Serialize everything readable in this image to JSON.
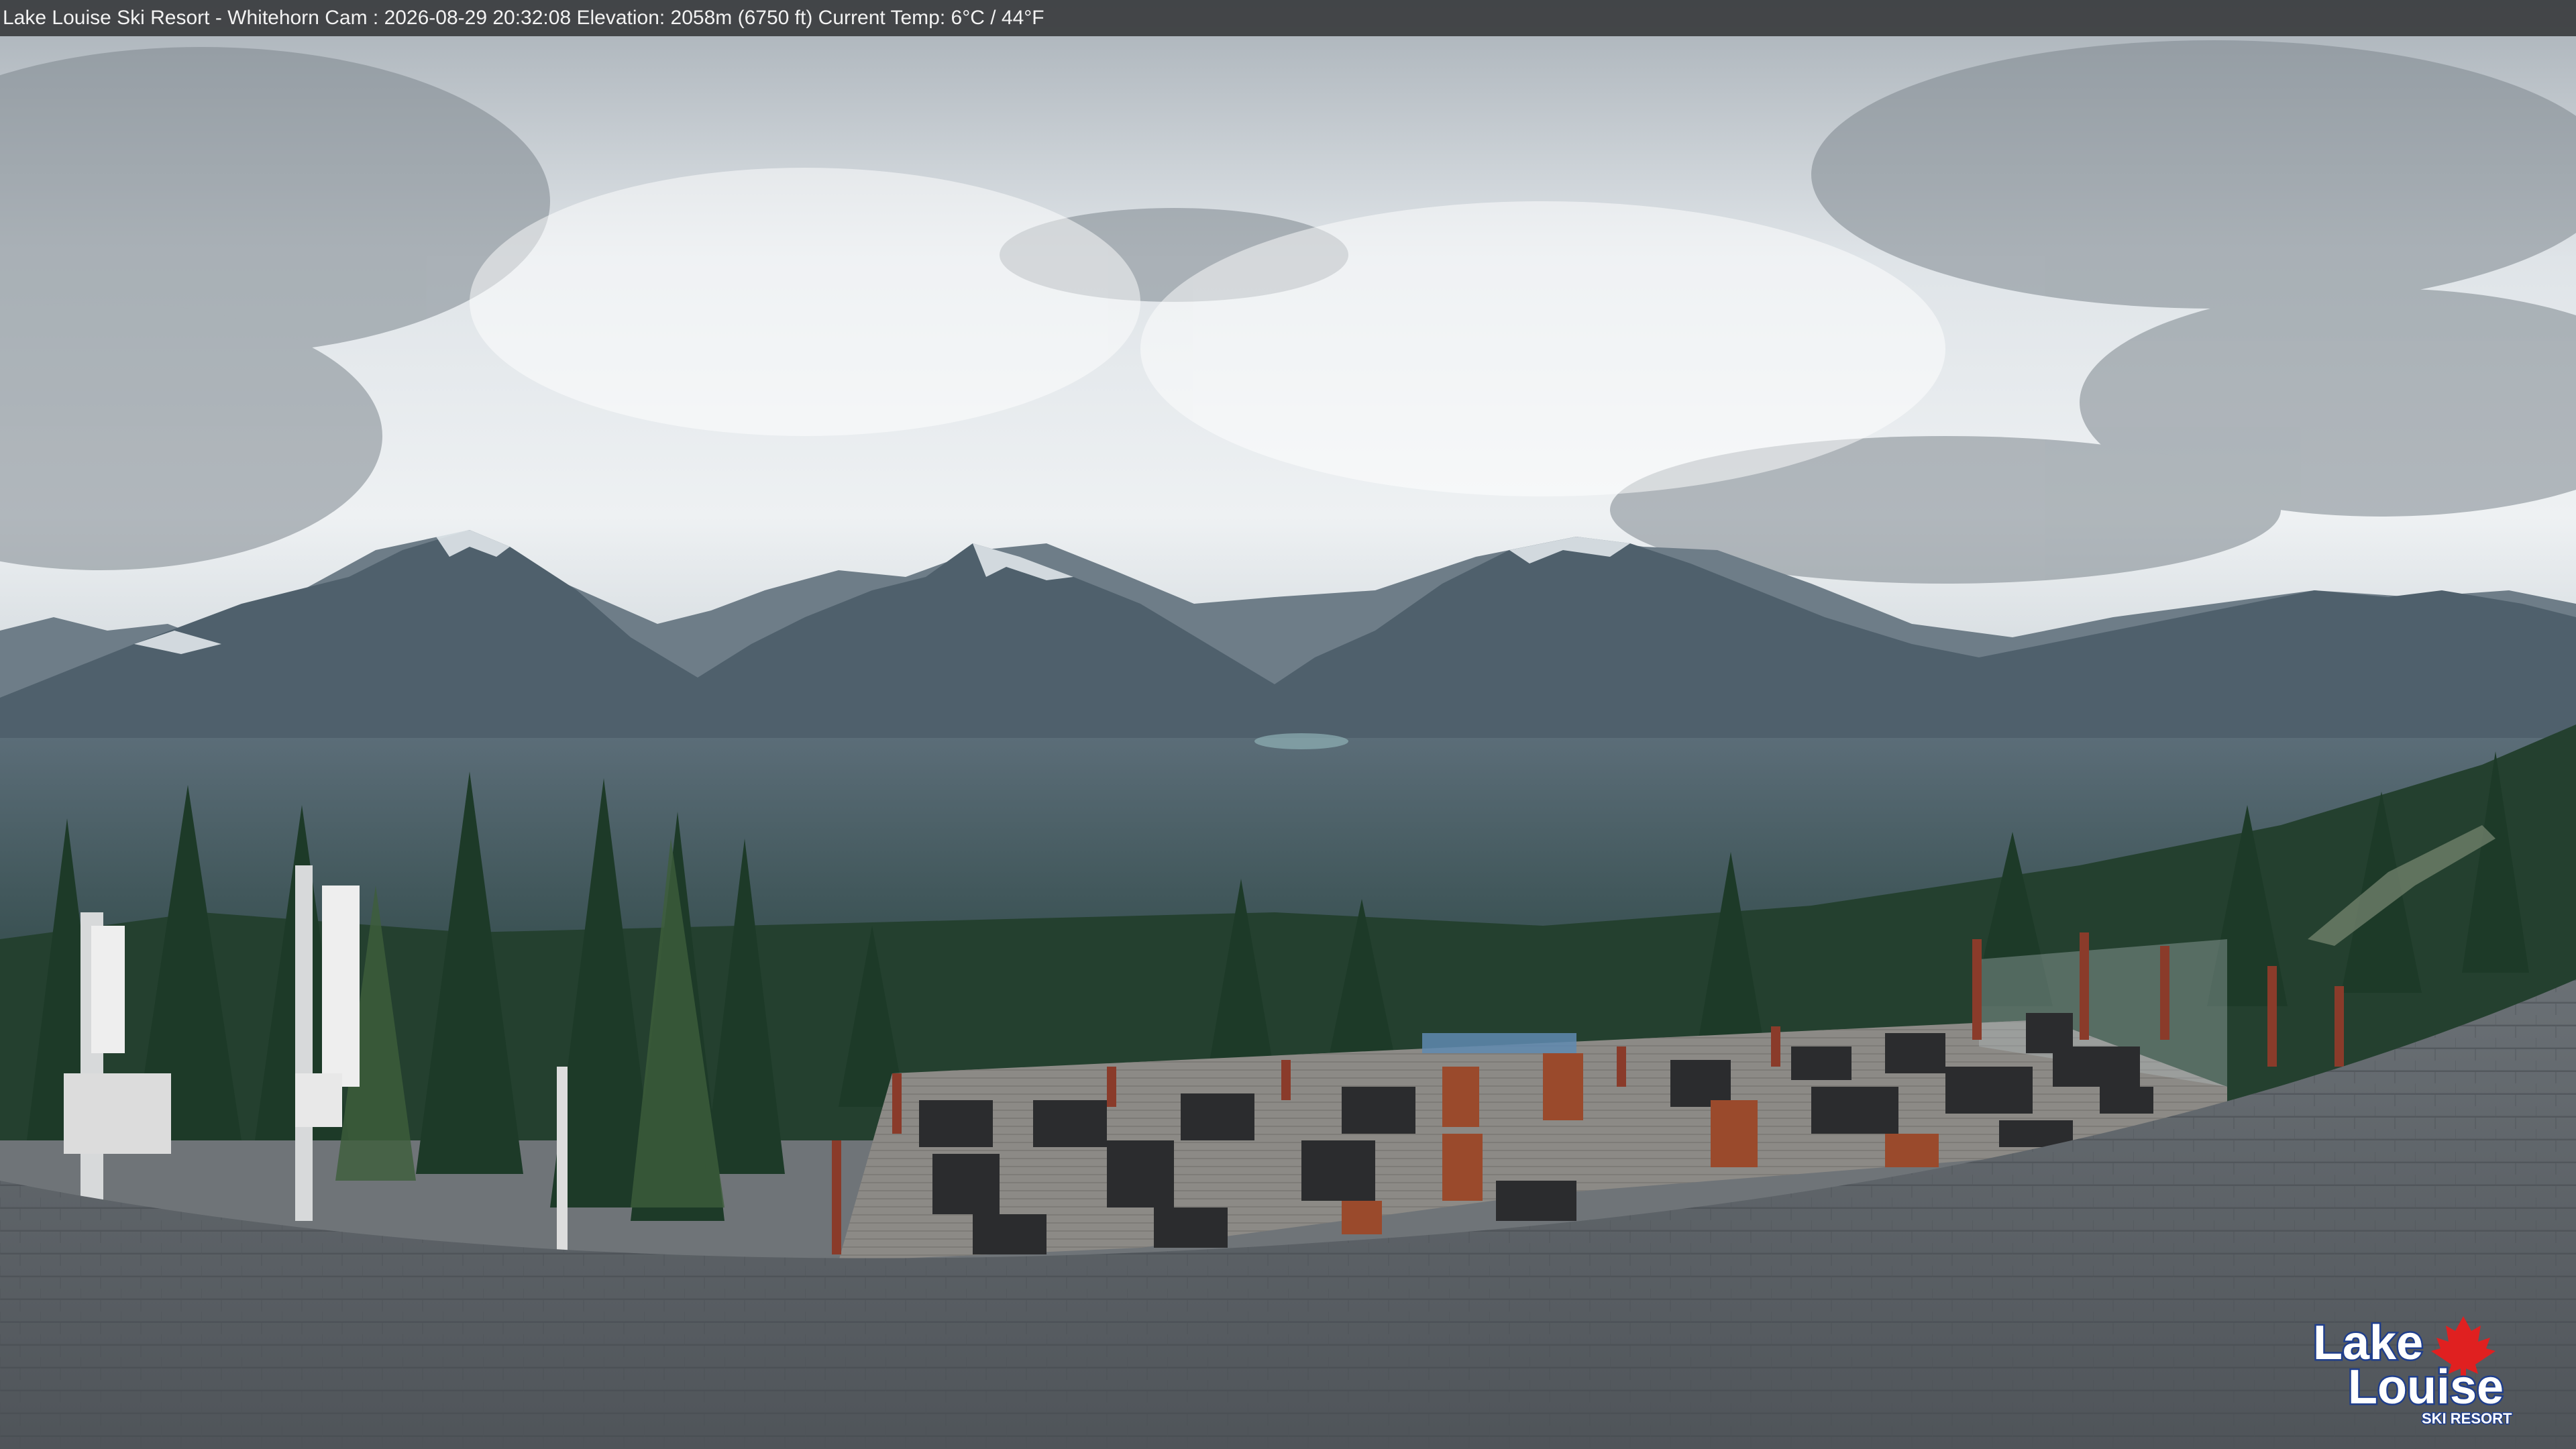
{
  "overlay": {
    "caption": "Lake Louise Ski Resort - Whitehorn Cam : 2026-08-29 20:32:08  Elevation: 2058m (6750 ft) Current Temp: 6°C / 44°F"
  },
  "logo": {
    "line1": "Lake",
    "line2": "Louise",
    "line3": "SKI RESORT",
    "text_color": "#ffffff",
    "outline_color": "#1f3e8c",
    "leaf_color": "#e02020"
  },
  "palette": {
    "sky_top": "#b9c0c6",
    "sky_mid": "#e7ebee",
    "mountain": "#4d5d69",
    "valley": "#3d5558",
    "forest": "#24402f",
    "deck": "#8c8a86",
    "roof": "#5c6166"
  }
}
